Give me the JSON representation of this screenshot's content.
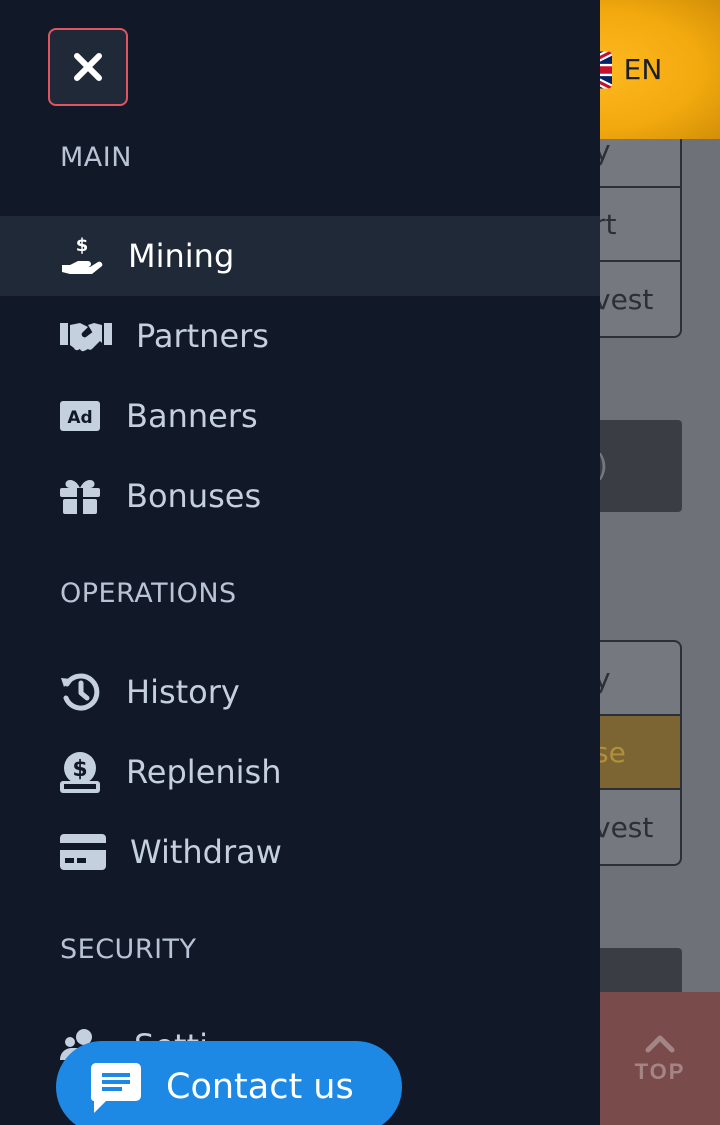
{
  "language": {
    "code": "EN",
    "flag": "uk-flag-icon"
  },
  "menu": {
    "close_icon": "close-icon",
    "sections": {
      "main": "MAIN",
      "operations": "OPERATIONS",
      "security": "SECURITY"
    },
    "items": {
      "mining": {
        "label": "Mining",
        "icon": "hand-money-icon",
        "active": true
      },
      "partners": {
        "label": "Partners",
        "icon": "handshake-icon"
      },
      "banners": {
        "label": "Banners",
        "icon": "ad-icon"
      },
      "bonuses": {
        "label": "Bonuses",
        "icon": "gift-icon"
      },
      "history": {
        "label": "History",
        "icon": "history-icon"
      },
      "replenish": {
        "label": "Replenish",
        "icon": "hand-coin-icon"
      },
      "withdraw": {
        "label": "Withdraw",
        "icon": "credit-card-icon"
      },
      "settings": {
        "label": "Setti",
        "icon": "users-gear-icon"
      }
    }
  },
  "background": {
    "card1": [
      "y",
      "rt",
      "vest"
    ],
    "block1": ")",
    "card2": [
      "y",
      "se",
      "vest"
    ]
  },
  "contact": {
    "label": "Contact us",
    "icon": "chat-icon"
  },
  "top_button": {
    "label": "TOP",
    "icon": "chevron-up-icon"
  },
  "colors": {
    "drawer": "#111827",
    "active_item": "#1f2937",
    "accent_blue": "#1e88e5",
    "lang_gold": "#f2a90e",
    "close_border": "#e05561"
  }
}
